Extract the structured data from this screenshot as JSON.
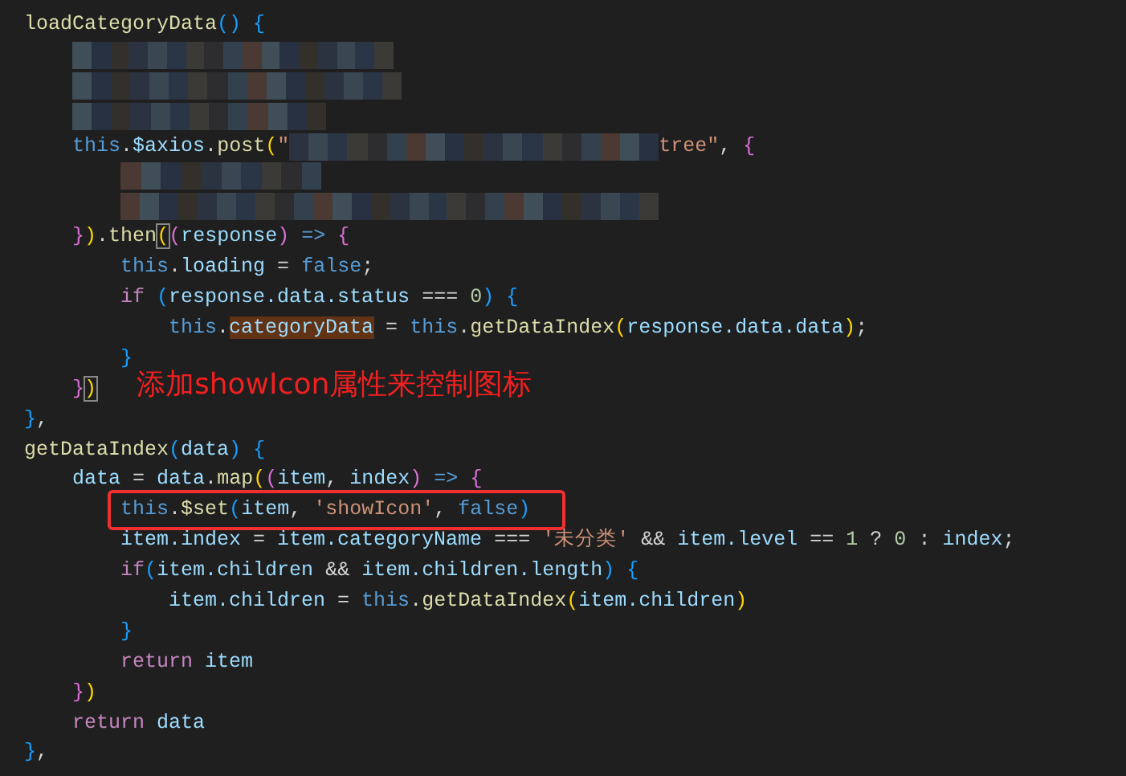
{
  "editor": {
    "lines": [
      {
        "boxed": false,
        "tokens": [
          {
            "text": "loadCategoryData",
            "kind": "fn"
          },
          {
            "text": "()",
            "kind": "b3"
          },
          {
            "text": " {",
            "kind": "b3"
          }
        ],
        "children": [
          {
            "boxed": false,
            "tokens": [
              {
                "kind": "blurred"
              }
            ]
          },
          {
            "boxed": false,
            "tokens": [
              {
                "kind": "blurred"
              }
            ]
          },
          {
            "boxed": false,
            "tokens": [
              {
                "kind": "blurred"
              }
            ]
          },
          {
            "boxed": false,
            "tokens": [
              {
                "text": "this",
                "kind": "kw"
              },
              {
                "text": "."
              },
              {
                "text": "$axios",
                "kind": "var"
              },
              {
                "text": "."
              },
              {
                "text": "post",
                "kind": "fn"
              },
              {
                "text": "(",
                "kind": "b1"
              },
              {
                "text": "\"",
                "kind": "str"
              },
              {
                "kind": "blurred"
              },
              {
                "text": "tree\"",
                "kind": "str"
              },
              {
                "text": ", "
              },
              {
                "text": "{",
                "kind": "b2"
              }
            ],
            "children": [
              {
                "boxed": false,
                "tokens": [
                  {
                    "kind": "blurred"
                  }
                ]
              },
              {
                "boxed": false,
                "tokens": [
                  {
                    "kind": "blurred"
                  }
                ]
              }
            ]
          },
          {
            "boxed": false,
            "tokens": [
              {
                "text": "}",
                "kind": "b2"
              },
              {
                "text": ")",
                "kind": "b1"
              },
              {
                "text": "."
              },
              {
                "text": "then",
                "kind": "fn"
              },
              {
                "text": "(",
                "kind": "b1-matched"
              },
              {
                "text": "(",
                "kind": "b2"
              },
              {
                "text": "response",
                "kind": "var"
              },
              {
                "text": ")",
                "kind": "b2"
              },
              {
                "text": " => ",
                "kind": "kw"
              },
              {
                "text": "{",
                "kind": "b2"
              }
            ],
            "children": [
              {
                "boxed": false,
                "tokens": [
                  {
                    "text": "this",
                    "kind": "kw"
                  },
                  {
                    "text": "."
                  },
                  {
                    "text": "loading",
                    "kind": "var"
                  },
                  {
                    "text": " = "
                  },
                  {
                    "text": "false",
                    "kind": "kw"
                  },
                  {
                    "text": ";"
                  }
                ]
              },
              {
                "boxed": false,
                "tokens": [
                  {
                    "text": "if ",
                    "kind": "ctrl"
                  },
                  {
                    "text": "(",
                    "kind": "b3"
                  },
                  {
                    "text": "response.data.status",
                    "kind": "var"
                  },
                  {
                    "text": " === "
                  },
                  {
                    "text": "0",
                    "kind": "num"
                  },
                  {
                    "text": ")",
                    "kind": "b3"
                  },
                  {
                    "text": " {",
                    "kind": "b3"
                  }
                ],
                "children": [
                  {
                    "boxed": false,
                    "tokens": [
                      {
                        "text": "this",
                        "kind": "kw"
                      },
                      {
                        "text": "."
                      },
                      {
                        "text": "categoryData",
                        "kind": "var-highlighted"
                      },
                      {
                        "text": " = "
                      },
                      {
                        "text": "this",
                        "kind": "kw"
                      },
                      {
                        "text": "."
                      },
                      {
                        "text": "getDataIndex",
                        "kind": "fn"
                      },
                      {
                        "text": "(",
                        "kind": "b1"
                      },
                      {
                        "text": "response.data.data",
                        "kind": "var"
                      },
                      {
                        "text": ")",
                        "kind": "b1"
                      },
                      {
                        "text": ";"
                      }
                    ]
                  }
                ]
              },
              {
                "boxed": false,
                "tokens": [
                  {
                    "text": "}",
                    "kind": "b3"
                  }
                ]
              }
            ]
          },
          {
            "boxed": false,
            "tokens": [
              {
                "text": "}",
                "kind": "b2"
              },
              {
                "text": ")",
                "kind": "b1-matched"
              }
            ]
          }
        ]
      },
      {
        "boxed": false,
        "tokens": [
          {
            "text": "}",
            "kind": "b3"
          },
          {
            "text": ","
          }
        ]
      },
      {
        "boxed": false,
        "tokens": [
          {
            "text": "getDataIndex",
            "kind": "fn"
          },
          {
            "text": "(",
            "kind": "b3"
          },
          {
            "text": "data",
            "kind": "var"
          },
          {
            "text": ")",
            "kind": "b3"
          },
          {
            "text": " {",
            "kind": "b3"
          }
        ],
        "children": [
          {
            "boxed": false,
            "tokens": [
              {
                "text": "data",
                "kind": "var"
              },
              {
                "text": " = "
              },
              {
                "text": "data",
                "kind": "var"
              },
              {
                "text": "."
              },
              {
                "text": "map",
                "kind": "fn"
              },
              {
                "text": "(",
                "kind": "b1"
              },
              {
                "text": "(",
                "kind": "b2"
              },
              {
                "text": "item",
                "kind": "var"
              },
              {
                "text": ", "
              },
              {
                "text": "index",
                "kind": "var"
              },
              {
                "text": ")",
                "kind": "b2"
              },
              {
                "text": " => ",
                "kind": "kw"
              },
              {
                "text": "{",
                "kind": "b2"
              }
            ],
            "children": [
              {
                "boxed": true,
                "tokens": [
                  {
                    "text": "this",
                    "kind": "kw"
                  },
                  {
                    "text": "."
                  },
                  {
                    "text": "$set",
                    "kind": "fn"
                  },
                  {
                    "text": "(",
                    "kind": "b3"
                  },
                  {
                    "text": "item",
                    "kind": "var"
                  },
                  {
                    "text": ", "
                  },
                  {
                    "text": "'showIcon'",
                    "kind": "str"
                  },
                  {
                    "text": ", "
                  },
                  {
                    "text": "false",
                    "kind": "kw"
                  },
                  {
                    "text": ")",
                    "kind": "b3"
                  }
                ]
              },
              {
                "boxed": false,
                "tokens": [
                  {
                    "text": "item.index",
                    "kind": "var"
                  },
                  {
                    "text": " = "
                  },
                  {
                    "text": "item.categoryName",
                    "kind": "var"
                  },
                  {
                    "text": " === "
                  },
                  {
                    "text": "'未分类'",
                    "kind": "str"
                  },
                  {
                    "text": " && "
                  },
                  {
                    "text": "item.level",
                    "kind": "var"
                  },
                  {
                    "text": " == "
                  },
                  {
                    "text": "1",
                    "kind": "num"
                  },
                  {
                    "text": " ? "
                  },
                  {
                    "text": "0",
                    "kind": "num"
                  },
                  {
                    "text": " : "
                  },
                  {
                    "text": "index",
                    "kind": "var"
                  },
                  {
                    "text": ";"
                  }
                ]
              },
              {
                "boxed": false,
                "tokens": [
                  {
                    "text": "if",
                    "kind": "ctrl"
                  },
                  {
                    "text": "(",
                    "kind": "b3"
                  },
                  {
                    "text": "item.children",
                    "kind": "var"
                  },
                  {
                    "text": " && "
                  },
                  {
                    "text": "item.children.length",
                    "kind": "var"
                  },
                  {
                    "text": ")",
                    "kind": "b3"
                  },
                  {
                    "text": " {",
                    "kind": "b3"
                  }
                ],
                "children": [
                  {
                    "boxed": false,
                    "tokens": [
                      {
                        "text": "item.children",
                        "kind": "var"
                      },
                      {
                        "text": " = "
                      },
                      {
                        "text": "this",
                        "kind": "kw"
                      },
                      {
                        "text": "."
                      },
                      {
                        "text": "getDataIndex",
                        "kind": "fn"
                      },
                      {
                        "text": "(",
                        "kind": "b1"
                      },
                      {
                        "text": "item.children",
                        "kind": "var"
                      },
                      {
                        "text": ")",
                        "kind": "b1"
                      }
                    ]
                  }
                ]
              },
              {
                "boxed": false,
                "tokens": [
                  {
                    "text": "}",
                    "kind": "b3"
                  }
                ]
              },
              {
                "boxed": false,
                "tokens": [
                  {
                    "text": "return ",
                    "kind": "ctrl"
                  },
                  {
                    "text": "item",
                    "kind": "var"
                  }
                ]
              }
            ]
          },
          {
            "boxed": false,
            "tokens": [
              {
                "text": "}",
                "kind": "b2"
              },
              {
                "text": ")",
                "kind": "b1"
              }
            ]
          },
          {
            "boxed": false,
            "tokens": [
              {
                "text": "return ",
                "kind": "ctrl"
              },
              {
                "text": "data",
                "kind": "var"
              }
            ]
          }
        ]
      },
      {
        "boxed": false,
        "tokens": [
          {
            "text": "}",
            "kind": "b3"
          },
          {
            "text": ","
          }
        ]
      }
    ]
  },
  "annotation": {
    "text": "添加showIcon属性来控制图标"
  }
}
